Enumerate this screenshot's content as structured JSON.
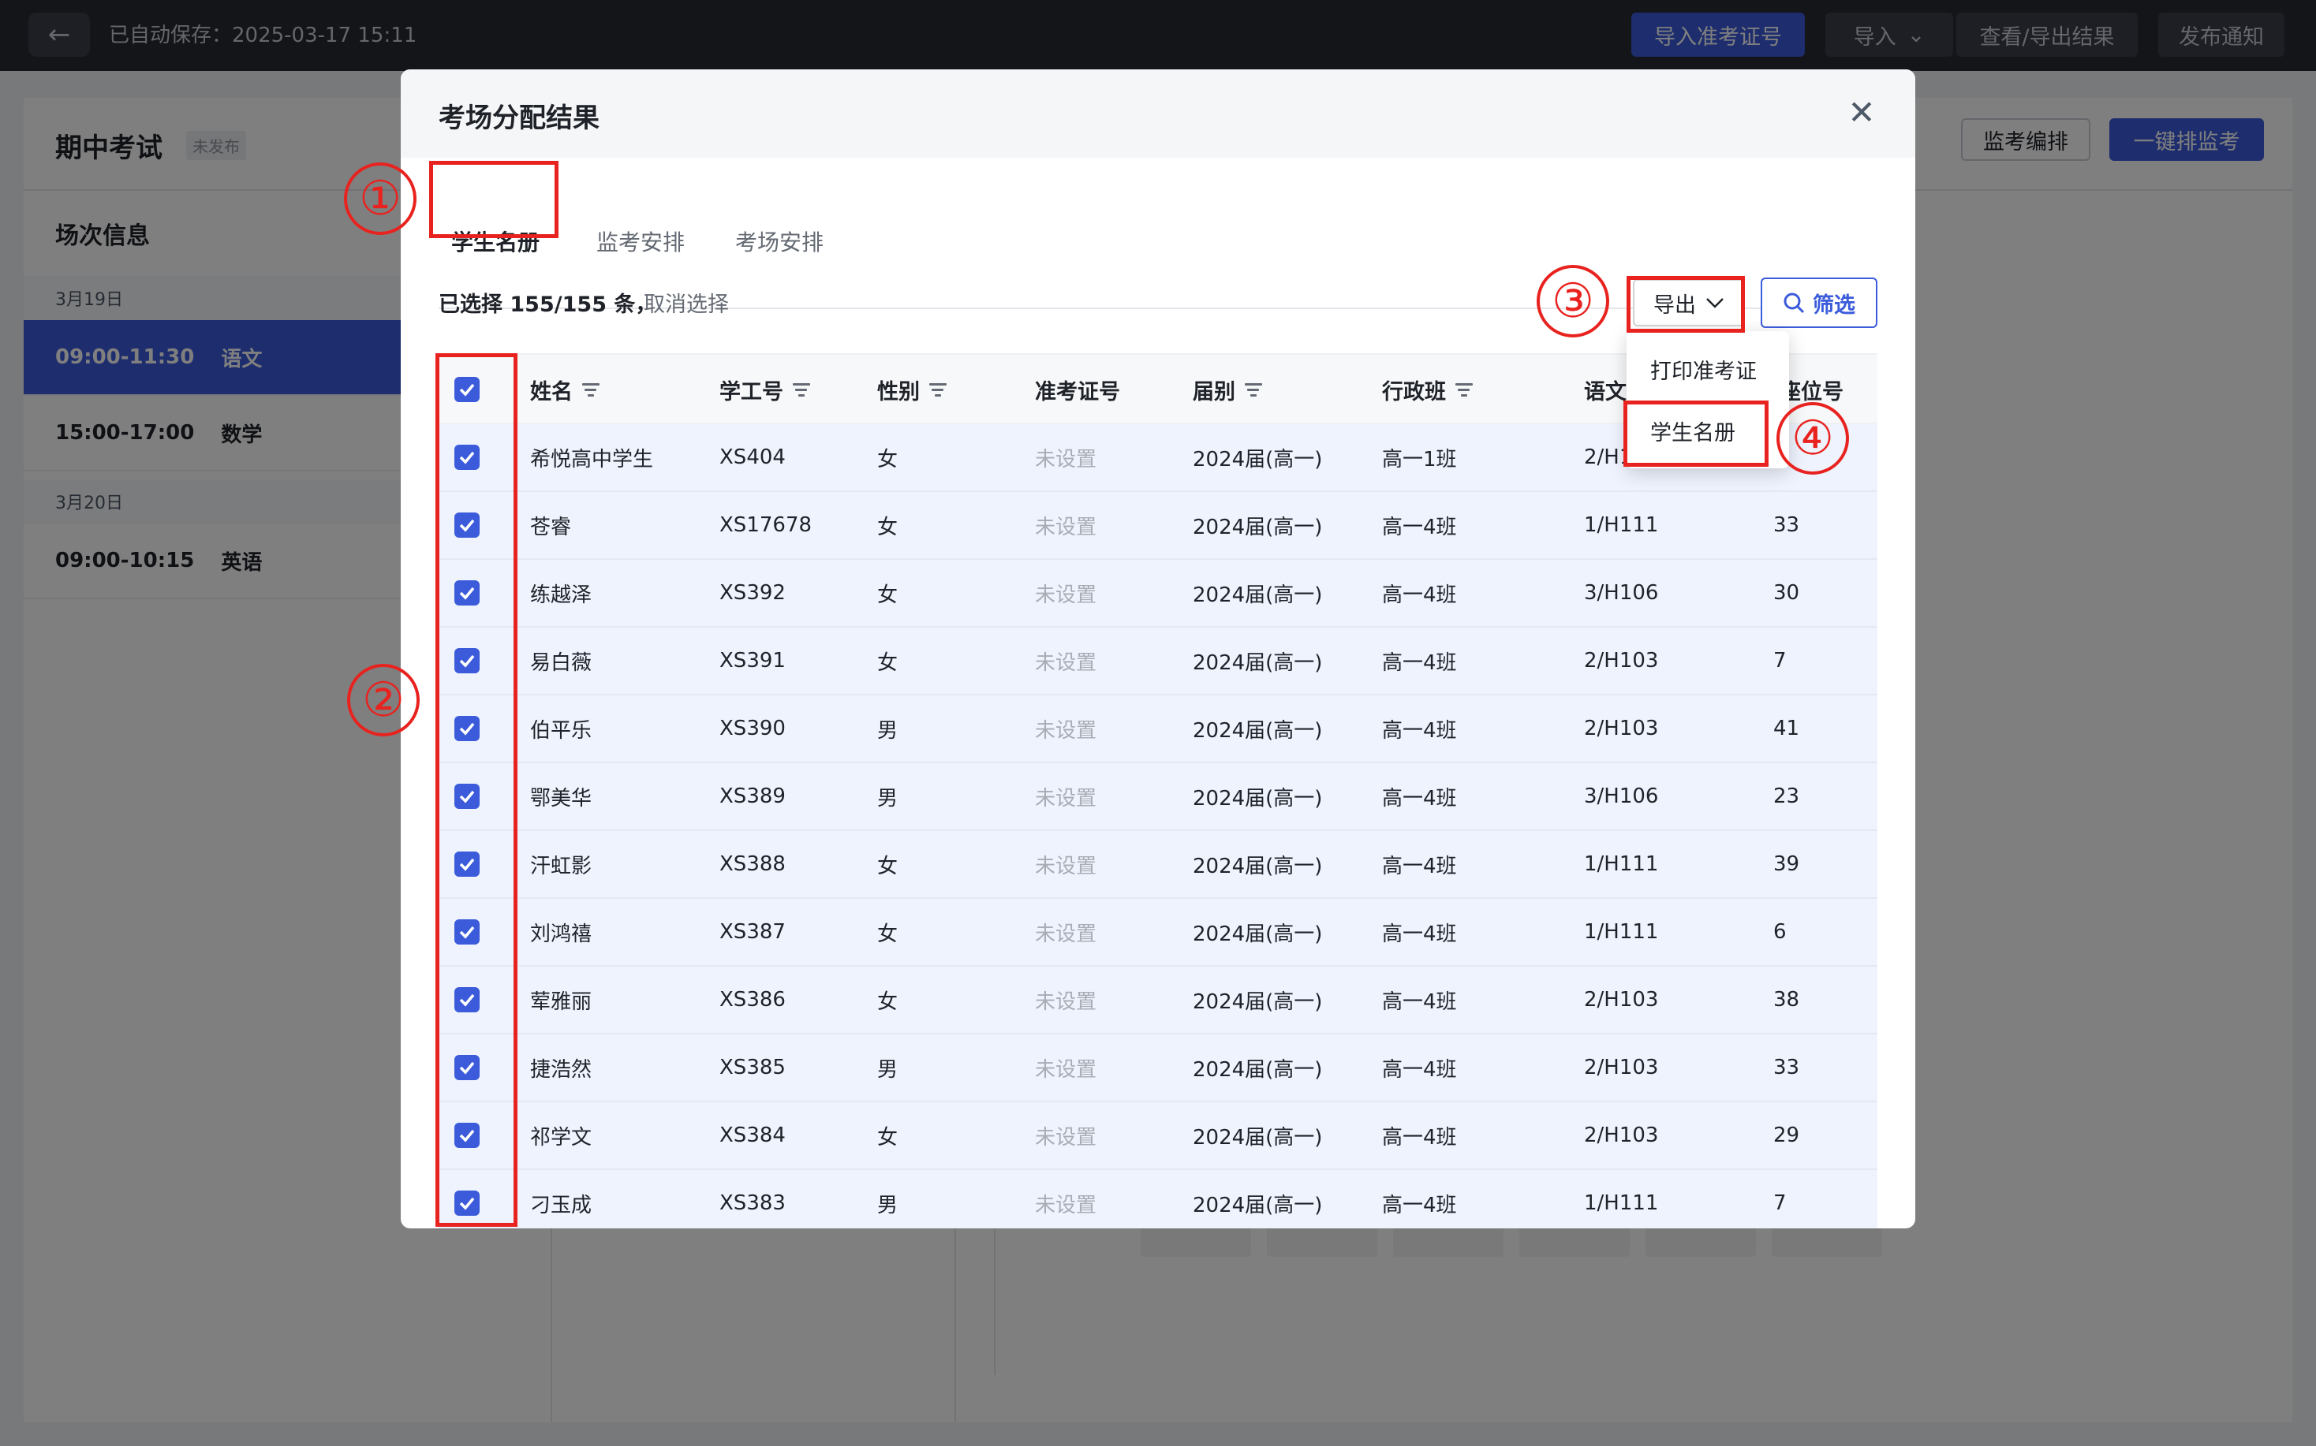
{
  "topbar": {
    "autosave": "已自动保存：2025-03-17 15:11",
    "btn_import_ticket": "导入准考证号",
    "btn_import": "导入",
    "btn_view_export": "查看/导出结果",
    "btn_publish": "发布通知"
  },
  "page": {
    "exam_title": "期中考试",
    "exam_status": "未发布",
    "session_title": "场次信息",
    "dates": [
      "3月19日",
      "3月20日"
    ],
    "sessions": [
      {
        "time": "09:00-11:30",
        "subject": "语文"
      },
      {
        "time": "15:00-17:00",
        "subject": "数学"
      },
      {
        "time": "09:00-10:15",
        "subject": "英语"
      }
    ],
    "btn_proctor_schedule": "监考编排",
    "btn_auto_proctor": "一键排监考"
  },
  "modal": {
    "title": "考场分配结果",
    "tabs": [
      "学生名册",
      "监考安排",
      "考场安排"
    ],
    "selection_info": "已选择 155/155 条，",
    "cancel_selection": "取消选择",
    "export_label": "导出",
    "filter_label": "筛选",
    "dropdown": [
      "打印准考证",
      "学生名册"
    ],
    "columns": [
      "姓名",
      "学工号",
      "性别",
      "准考证号",
      "届别",
      "行政班",
      "语文考场",
      "座位号"
    ],
    "rows": [
      {
        "name": "希悦高中学生",
        "id": "XS404",
        "gender": "女",
        "ticket": "未设置",
        "grade": "2024届(高一)",
        "class": "高一1班",
        "room": "2/H103",
        "seat": ""
      },
      {
        "name": "苍睿",
        "id": "XS17678",
        "gender": "女",
        "ticket": "未设置",
        "grade": "2024届(高一)",
        "class": "高一4班",
        "room": "1/H111",
        "seat": "33"
      },
      {
        "name": "练越泽",
        "id": "XS392",
        "gender": "女",
        "ticket": "未设置",
        "grade": "2024届(高一)",
        "class": "高一4班",
        "room": "3/H106",
        "seat": "30"
      },
      {
        "name": "易白薇",
        "id": "XS391",
        "gender": "女",
        "ticket": "未设置",
        "grade": "2024届(高一)",
        "class": "高一4班",
        "room": "2/H103",
        "seat": "7"
      },
      {
        "name": "伯平乐",
        "id": "XS390",
        "gender": "男",
        "ticket": "未设置",
        "grade": "2024届(高一)",
        "class": "高一4班",
        "room": "2/H103",
        "seat": "41"
      },
      {
        "name": "鄂美华",
        "id": "XS389",
        "gender": "男",
        "ticket": "未设置",
        "grade": "2024届(高一)",
        "class": "高一4班",
        "room": "3/H106",
        "seat": "23"
      },
      {
        "name": "汗虹影",
        "id": "XS388",
        "gender": "女",
        "ticket": "未设置",
        "grade": "2024届(高一)",
        "class": "高一4班",
        "room": "1/H111",
        "seat": "39"
      },
      {
        "name": "刘鸿禧",
        "id": "XS387",
        "gender": "女",
        "ticket": "未设置",
        "grade": "2024届(高一)",
        "class": "高一4班",
        "room": "1/H111",
        "seat": "6"
      },
      {
        "name": "荤雅丽",
        "id": "XS386",
        "gender": "女",
        "ticket": "未设置",
        "grade": "2024届(高一)",
        "class": "高一4班",
        "room": "2/H103",
        "seat": "38"
      },
      {
        "name": "捷浩然",
        "id": "XS385",
        "gender": "男",
        "ticket": "未设置",
        "grade": "2024届(高一)",
        "class": "高一4班",
        "room": "2/H103",
        "seat": "33"
      },
      {
        "name": "祁学文",
        "id": "XS384",
        "gender": "女",
        "ticket": "未设置",
        "grade": "2024届(高一)",
        "class": "高一4班",
        "room": "2/H103",
        "seat": "29"
      },
      {
        "name": "刁玉成",
        "id": "XS383",
        "gender": "男",
        "ticket": "未设置",
        "grade": "2024届(高一)",
        "class": "高一4班",
        "room": "1/H111",
        "seat": "7"
      }
    ]
  },
  "annotations": [
    "①",
    "②",
    "③",
    "④"
  ],
  "colors": {
    "accent": "#3b5bdb",
    "annotation": "#e8231f",
    "row_bg": "#eef3fd"
  }
}
